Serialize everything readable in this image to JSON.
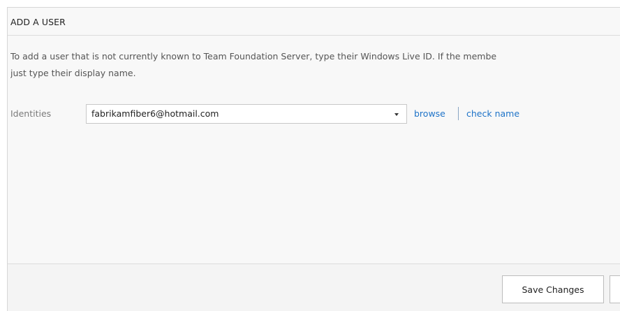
{
  "dialog": {
    "title": "ADD A USER",
    "description_line1": "To add a user that is not currently known to Team Foundation Server, type their Windows Live ID. If the membe",
    "description_line2": "just type their display name."
  },
  "identities": {
    "label": "Identities",
    "value": "fabrikamfiber6@hotmail.com",
    "dropdown_icon": "caret-down-icon",
    "browse_label": "browse",
    "check_name_label": "check name"
  },
  "footer": {
    "save_label": "Save Changes",
    "cancel_label": ""
  },
  "colors": {
    "link": "#1e73c8",
    "dialog_background": "#f8f8f8",
    "border": "#d6d6d6"
  }
}
